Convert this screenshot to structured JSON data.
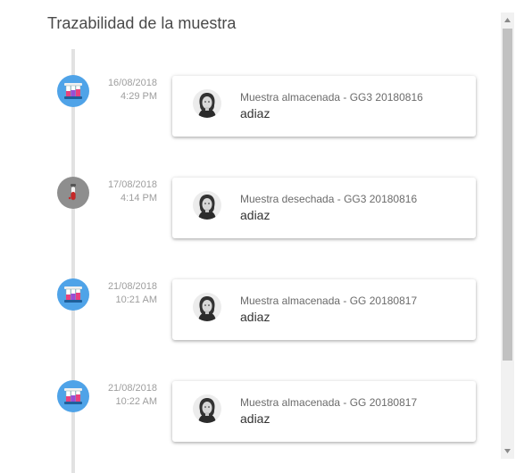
{
  "page": {
    "title": "Trazabilidad de la muestra"
  },
  "timeline": [
    {
      "status": "stored",
      "icon": "test-tubes-icon",
      "date": "16/08/2018",
      "time": "4:29 PM",
      "description": "Muestra almacenada - GG3 20180816",
      "user": "adiaz"
    },
    {
      "status": "discarded",
      "icon": "discarded-tube-icon",
      "date": "17/08/2018",
      "time": "4:14 PM",
      "description": "Muestra desechada - GG3 20180816",
      "user": "adiaz"
    },
    {
      "status": "stored",
      "icon": "test-tubes-icon",
      "date": "21/08/2018",
      "time": "10:21 AM",
      "description": "Muestra almacenada - GG 20180817",
      "user": "adiaz"
    },
    {
      "status": "stored",
      "icon": "test-tubes-icon",
      "date": "21/08/2018",
      "time": "10:22 AM",
      "description": "Muestra almacenada - GG 20180817",
      "user": "adiaz"
    }
  ],
  "colors": {
    "stored_marker": "#4fa3e8",
    "discarded_marker": "#8e8e8e",
    "timeline_line": "#e2e2e2",
    "scroll_thumb": "#c1c1c1"
  }
}
